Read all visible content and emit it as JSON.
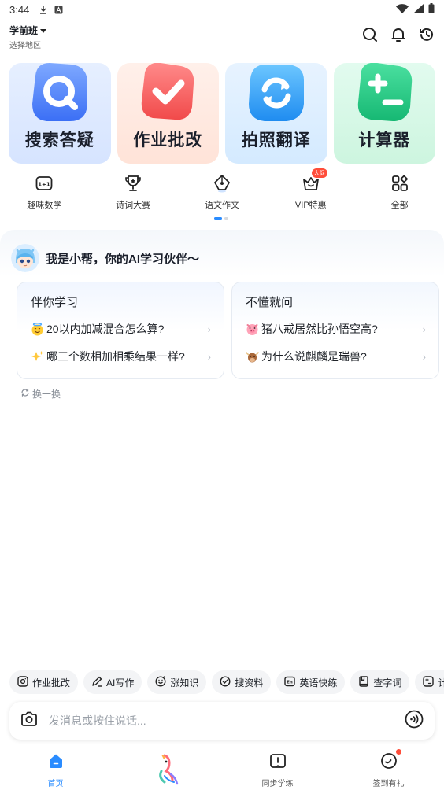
{
  "status_bar": {
    "time": "3:44"
  },
  "header": {
    "grade": "学前班",
    "region": "选择地区"
  },
  "feature_cards": [
    {
      "label": "搜索答疑",
      "icon": "search-icon"
    },
    {
      "label": "作业批改",
      "icon": "check-icon"
    },
    {
      "label": "拍照翻译",
      "icon": "sync-icon"
    },
    {
      "label": "计算器",
      "icon": "calculator-icon"
    }
  ],
  "tools": [
    {
      "label": "趣味数学",
      "icon": "math-card-icon"
    },
    {
      "label": "诗词大赛",
      "icon": "trophy-icon"
    },
    {
      "label": "语文作文",
      "icon": "pen-nib-icon"
    },
    {
      "label": "VIP特惠",
      "icon": "crown-icon",
      "badge": "大促"
    },
    {
      "label": "全部",
      "icon": "grid-icon"
    }
  ],
  "chat": {
    "greeting": "我是小帮，你的AI学习伙伴～",
    "cards": [
      {
        "title": "伴你学习",
        "questions": [
          {
            "text": "20以内加减混合怎么算?",
            "emoji": "halo-smile-emoji"
          },
          {
            "text": "哪三个数相加相乘结果一样?",
            "emoji": "sparkles-emoji"
          }
        ]
      },
      {
        "title": "不懂就问",
        "questions": [
          {
            "text": "猪八戒居然比孙悟空高?",
            "emoji": "pig-emoji"
          },
          {
            "text": "为什么说麒麟是瑞兽?",
            "emoji": "ox-emoji"
          }
        ]
      }
    ],
    "refresh_label": "换一换"
  },
  "quick_chips": [
    {
      "label": "作业批改",
      "icon": "camera-square-icon"
    },
    {
      "label": "AI写作",
      "icon": "pencil-icon"
    },
    {
      "label": "涨知识",
      "icon": "smile-bulb-icon"
    },
    {
      "label": "搜资料",
      "icon": "check-circle-icon"
    },
    {
      "label": "英语快练",
      "icon": "en-icon"
    },
    {
      "label": "查字词",
      "icon": "book-icon"
    },
    {
      "label": "计算",
      "icon": "calc-square-icon"
    }
  ],
  "input": {
    "placeholder": "发消息或按住说话..."
  },
  "bottom_nav": [
    {
      "label": "首页",
      "icon": "home-icon",
      "active": true
    },
    {
      "label": "",
      "icon": "mascot-bird-icon"
    },
    {
      "label": "同步学练",
      "icon": "open-book-icon"
    },
    {
      "label": "签到有礼",
      "icon": "checkin-icon",
      "dot": true
    }
  ],
  "colors": {
    "accent": "#2a8cff",
    "badge": "#ff4d3a"
  }
}
